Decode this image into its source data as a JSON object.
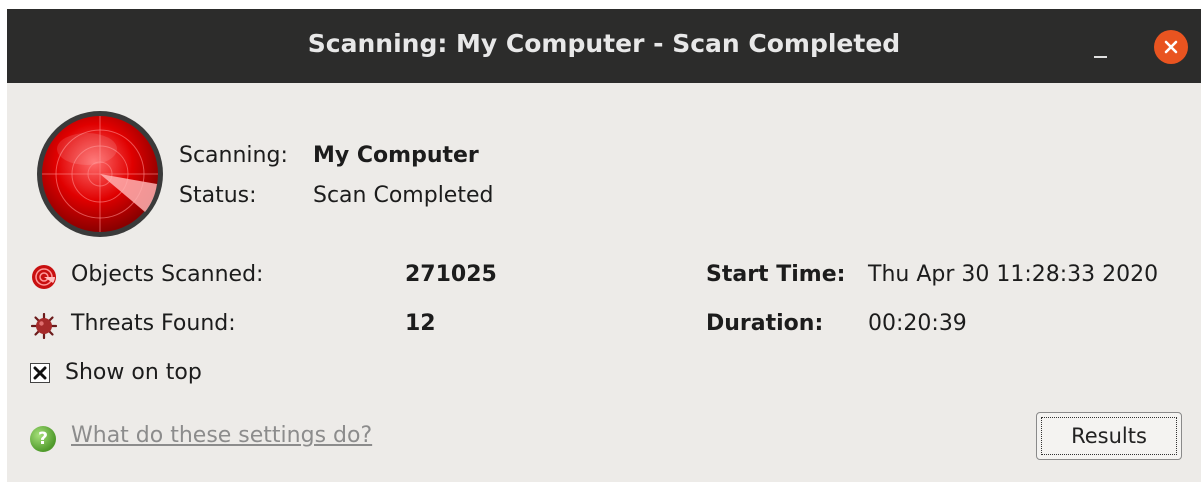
{
  "window": {
    "title": "Scanning: My Computer - Scan Completed"
  },
  "scan": {
    "scanning_label": "Scanning:",
    "scanning_value": "My Computer",
    "status_label": "Status:",
    "status_value": "Scan Completed"
  },
  "stats": {
    "objects_label": "Objects Scanned:",
    "objects_value": "271025",
    "threats_label": "Threats Found:",
    "threats_value": "12",
    "start_label": "Start Time:",
    "start_value": "Thu Apr 30 11:28:33 2020",
    "duration_label": "Duration:",
    "duration_value": "00:20:39"
  },
  "options": {
    "show_on_top_label": "Show on top",
    "show_on_top_checked": true
  },
  "footer": {
    "help_link": "What do these settings do?",
    "results_button": "Results"
  },
  "icons": {
    "radar": "radar-icon",
    "objects": "objects-scanned-icon",
    "threats": "virus-icon",
    "help": "help-icon",
    "close": "close-icon",
    "minimize": "minimize-icon"
  },
  "colors": {
    "titlebar": "#2c2c2b",
    "close_button": "#e95420",
    "window_bg": "#edebe8",
    "radar_red": "#d40000"
  }
}
